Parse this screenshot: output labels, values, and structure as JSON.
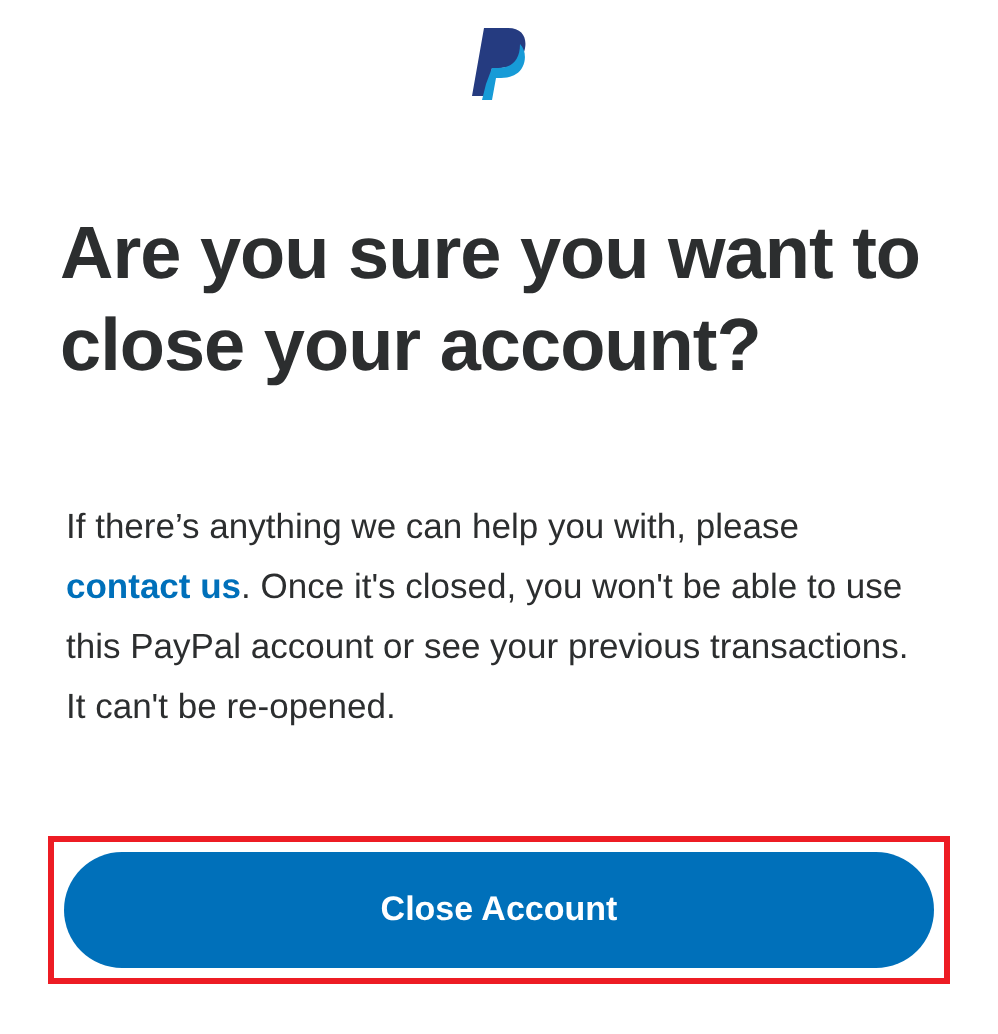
{
  "heading": "Are you sure you want to close your account?",
  "message": {
    "before": "If there’s anything we can help you with, please ",
    "link": "contact us",
    "after": ". Once it's closed, you won't be able to use this PayPal account or see your previous transactions. It can't be re-opened."
  },
  "button": {
    "label": "Close Account",
    "highlighted": true
  }
}
